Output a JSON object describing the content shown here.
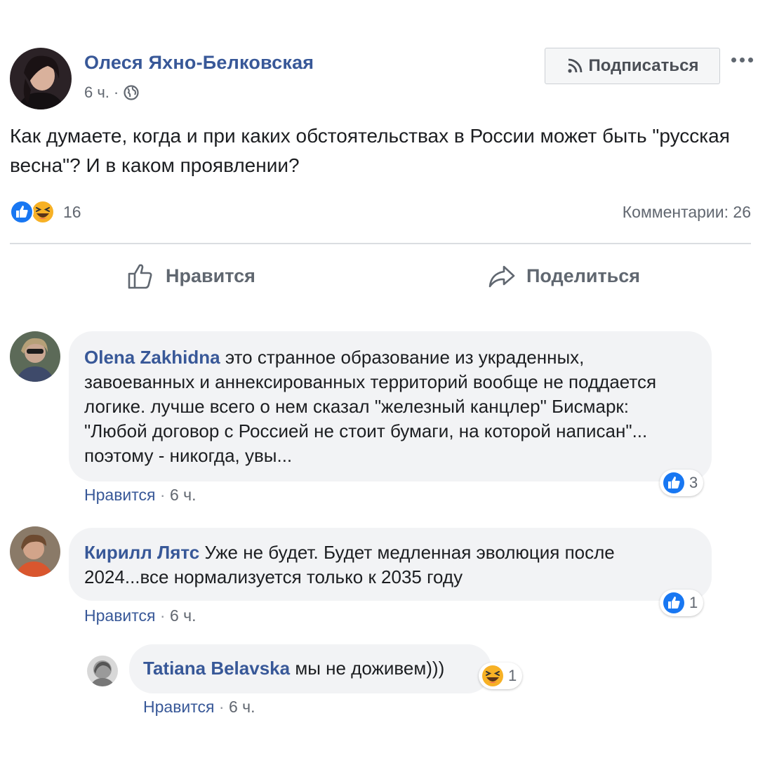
{
  "post": {
    "author": "Олеся Яхно-Белковская",
    "time": "6 ч.",
    "separator": "·",
    "text": "Как думаете, когда и при каких обстоятельствах в России может быть \"русская весна\"? И в каком проявлении?",
    "subscribe_label": "Подписаться",
    "reactions_count": "16",
    "comments_label": "Комментарии: 26",
    "like_label": "Нравится",
    "share_label": "Поделиться"
  },
  "comments": [
    {
      "author": "Olena Zakhidna",
      "text": "это странное образование из украденных, завоеванных и аннексированных территорий вообще не поддается логике. лучше всего о нем сказал \"железный канцлер\" Бисмарк: \"Любой договор с Россией не стоит бумаги, на которой написан\"... поэтому - никогда, увы...",
      "like_label": "Нравится",
      "time": "6 ч.",
      "reaction_count": "3"
    },
    {
      "author": "Кирилл Лятс",
      "text": "Уже не будет. Будет медленная эволюция после 2024...все нормализуется только к 2035 году",
      "like_label": "Нравится",
      "time": "6 ч.",
      "reaction_count": "1"
    }
  ],
  "reply": {
    "author": "Tatiana Belavska",
    "text": "мы не доживем)))",
    "like_label": "Нравится",
    "time": "6 ч.",
    "reaction_count": "1"
  },
  "colors": {
    "link": "#385898",
    "like_blue": "#1877f2",
    "haha_yellow": "#f7b125",
    "bubble": "#f2f3f5"
  },
  "icons": {
    "like_reaction": "thumbs-up-icon",
    "haha_reaction": "laughing-face-icon",
    "globe": "globe-icon",
    "rss": "rss-icon",
    "share": "share-arrow-icon",
    "more": "more-dots-icon"
  }
}
